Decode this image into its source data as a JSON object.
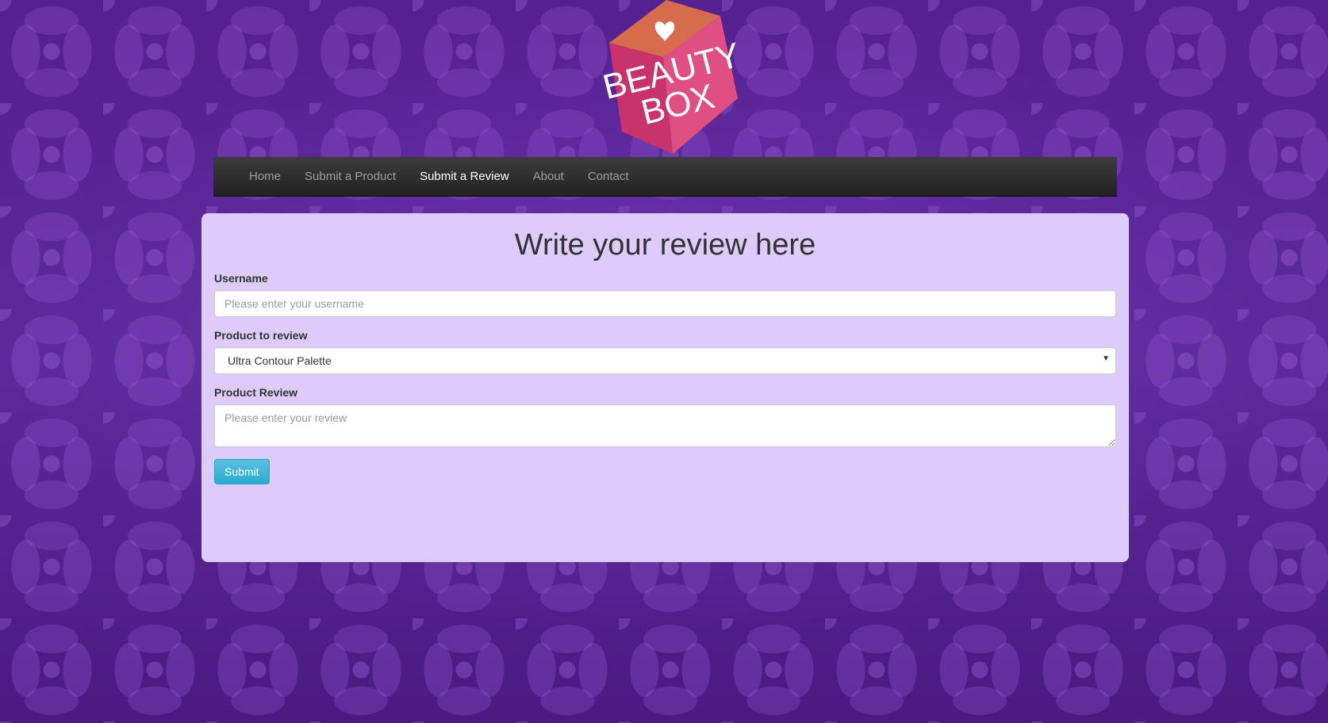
{
  "brand": {
    "logo_text_line1": "BEAUTY",
    "logo_text_line2": "BOX",
    "colors": {
      "box_front": "#c8336b",
      "box_right": "#e0507f",
      "box_top": "#d66b4d"
    }
  },
  "nav": {
    "items": [
      {
        "label": "Home",
        "active": false
      },
      {
        "label": "Submit a Product",
        "active": false
      },
      {
        "label": "Submit a Review",
        "active": true
      },
      {
        "label": "About",
        "active": false
      },
      {
        "label": "Contact",
        "active": false
      }
    ]
  },
  "form": {
    "title": "Write your review here",
    "username": {
      "label": "Username",
      "value": "",
      "placeholder": "Please enter your username"
    },
    "product": {
      "label": "Product to review",
      "selected": "Ultra Contour Palette"
    },
    "review": {
      "label": "Product Review",
      "value": "",
      "placeholder": "Please enter your review"
    },
    "submit_label": "Submit"
  },
  "colors": {
    "panel_bg": "#dccbfb",
    "navbar_bg": "#222222",
    "submit_bg": "#31b0d5",
    "page_bg": "#5a2a98"
  }
}
